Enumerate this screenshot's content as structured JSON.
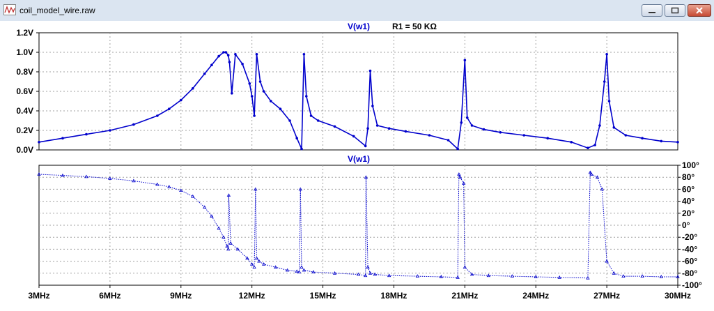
{
  "window": {
    "title": "coil_model_wire.raw",
    "buttons": [
      "minimize",
      "maximize",
      "close"
    ],
    "icon": "waveform-app-icon"
  },
  "colors": {
    "trace": "#0000cc",
    "grid": "#a0a0a0",
    "axis_text": "#000000"
  },
  "chart_data": [
    {
      "type": "line",
      "title": "V(w1)",
      "annotation": "R1 = 50 KΩ",
      "xlabel": "",
      "ylabel": "",
      "xlim": [
        3,
        30
      ],
      "ylim": [
        0,
        1.2
      ],
      "yticks": [
        "0.0V",
        "0.2V",
        "0.4V",
        "0.6V",
        "0.8V",
        "1.0V",
        "1.2V"
      ],
      "grid": true,
      "x_unit": "MHz",
      "series": [
        {
          "x": [
            3,
            4,
            5,
            6,
            7,
            8,
            8.5,
            9,
            9.5,
            10,
            10.3,
            10.6,
            10.8,
            10.9,
            11.0,
            11.05,
            11.15,
            11.3,
            11.6,
            11.9,
            12.0,
            12.1,
            12.2,
            12.35,
            12.5,
            12.8,
            13.2,
            13.6,
            13.9,
            14.1,
            14.2,
            14.3,
            14.5,
            14.8,
            15.5,
            16.3,
            16.8,
            16.9,
            17.0,
            17.1,
            17.3,
            17.8,
            18.5,
            19.5,
            20.3,
            20.7,
            20.85,
            21.0,
            21.1,
            21.3,
            21.8,
            22.5,
            23.5,
            24.5,
            25.5,
            26.2,
            26.5,
            26.7,
            26.9,
            27.0,
            27.1,
            27.3,
            27.8,
            28.5,
            29.3,
            30
          ],
          "y": [
            0.08,
            0.12,
            0.16,
            0.2,
            0.26,
            0.35,
            0.42,
            0.51,
            0.63,
            0.78,
            0.87,
            0.96,
            1.0,
            1.0,
            0.97,
            0.9,
            0.58,
            0.98,
            0.88,
            0.68,
            0.55,
            0.35,
            0.98,
            0.7,
            0.6,
            0.5,
            0.42,
            0.3,
            0.12,
            0.01,
            0.98,
            0.55,
            0.35,
            0.3,
            0.24,
            0.14,
            0.04,
            0.22,
            0.81,
            0.45,
            0.25,
            0.22,
            0.19,
            0.15,
            0.1,
            0.01,
            0.28,
            0.92,
            0.33,
            0.25,
            0.21,
            0.18,
            0.15,
            0.12,
            0.08,
            0.02,
            0.05,
            0.25,
            0.7,
            0.98,
            0.5,
            0.23,
            0.15,
            0.12,
            0.09,
            0.08
          ]
        }
      ]
    },
    {
      "type": "line",
      "title": "V(w1)",
      "xlabel": "",
      "ylabel": "",
      "xlim": [
        3,
        30
      ],
      "xticks": [
        "3MHz",
        "6MHz",
        "9MHz",
        "12MHz",
        "15MHz",
        "18MHz",
        "21MHz",
        "24MHz",
        "27MHz",
        "30MHz"
      ],
      "ylim": [
        -100,
        100
      ],
      "yticks": [
        "100°",
        "80°",
        "60°",
        "40°",
        "20°",
        "0°",
        "-20°",
        "-40°",
        "-60°",
        "-80°",
        "-100°"
      ],
      "grid": true,
      "series": [
        {
          "x": [
            3,
            4,
            5,
            6,
            7,
            8,
            8.5,
            9,
            9.5,
            10,
            10.3,
            10.6,
            10.8,
            10.95,
            11.0,
            11.02,
            11.1,
            11.4,
            11.8,
            12.0,
            12.1,
            12.15,
            12.2,
            12.3,
            12.5,
            13.0,
            13.5,
            13.9,
            14.0,
            14.05,
            14.1,
            14.2,
            14.6,
            15.5,
            16.5,
            16.8,
            16.82,
            16.9,
            17.0,
            17.2,
            17.8,
            19,
            20,
            20.7,
            20.75,
            20.8,
            20.95,
            21.0,
            21.3,
            22,
            23,
            24,
            25,
            26.2,
            26.3,
            26.35,
            26.6,
            26.8,
            27.0,
            27.3,
            27.7,
            28.5,
            29.3,
            30
          ],
          "y": [
            85,
            83,
            81,
            78,
            74,
            68,
            64,
            58,
            48,
            30,
            15,
            -5,
            -20,
            -35,
            -40,
            50,
            -30,
            -40,
            -55,
            -65,
            -70,
            60,
            -55,
            -60,
            -65,
            -70,
            -75,
            -77,
            -78,
            60,
            -70,
            -75,
            -78,
            -80,
            -82,
            -84,
            80,
            -70,
            -80,
            -82,
            -84,
            -85,
            -86,
            -87,
            85,
            80,
            70,
            -70,
            -82,
            -84,
            -85,
            -86,
            -87,
            -88,
            88,
            85,
            80,
            60,
            -60,
            -80,
            -85,
            -85,
            -86,
            -86
          ]
        }
      ]
    }
  ]
}
